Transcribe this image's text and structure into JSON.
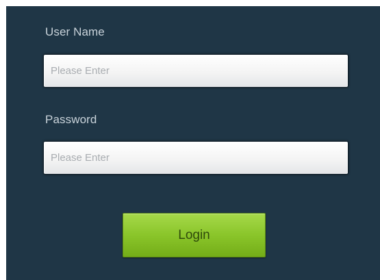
{
  "form": {
    "username_label": "User Name",
    "username_placeholder": "Please Enter",
    "password_label": "Password",
    "password_placeholder": "Please Enter",
    "login_label": "Login"
  },
  "colors": {
    "panel_background": "#1f3646",
    "label_text": "#c9d3da",
    "button_green": "#8ac52a"
  }
}
